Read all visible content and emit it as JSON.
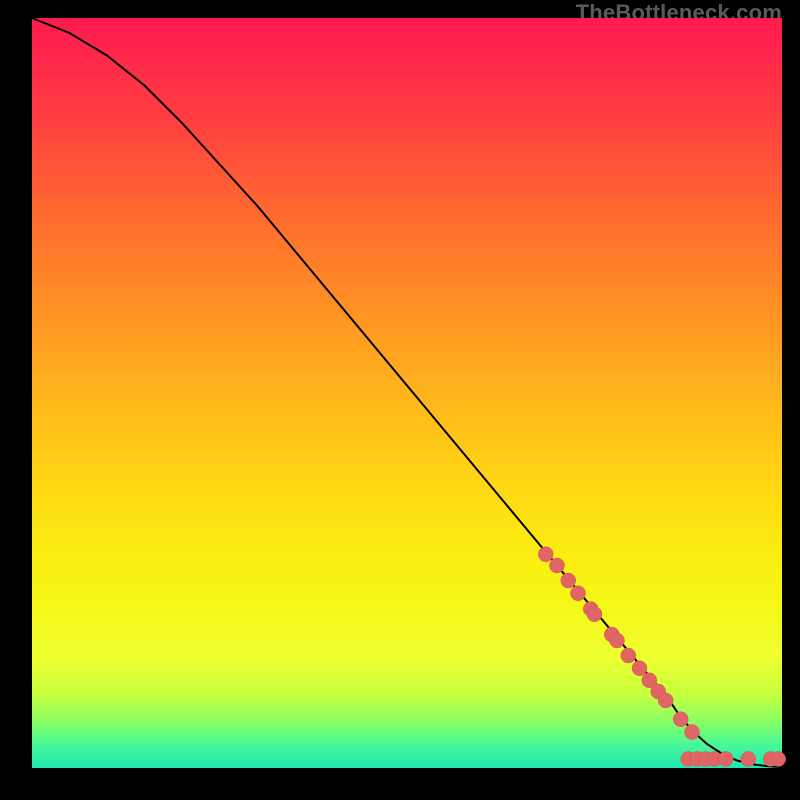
{
  "watermark": "TheBottleneck.com",
  "colors": {
    "page_bg": "#000000",
    "marker_fill": "#e06666",
    "marker_stroke": "#d94f4f",
    "curve_stroke": "#000000"
  },
  "chart_data": {
    "type": "line",
    "title": "",
    "xlabel": "",
    "ylabel": "",
    "xlim": [
      0,
      100
    ],
    "ylim": [
      0,
      100
    ],
    "grid": false,
    "legend": false,
    "series": [
      {
        "name": "curve",
        "kind": "line",
        "x": [
          0,
          5,
          10,
          15,
          20,
          25,
          30,
          35,
          40,
          45,
          50,
          55,
          60,
          65,
          70,
          75,
          80,
          85,
          86,
          88,
          90,
          92,
          94,
          96,
          98,
          100
        ],
        "y": [
          100,
          98,
          95,
          91,
          86,
          80.5,
          75,
          69,
          63,
          57,
          51,
          45,
          39,
          33,
          27,
          21,
          15,
          9,
          7.5,
          5.0,
          3.2,
          1.9,
          1.0,
          0.5,
          0.25,
          0.12
        ]
      },
      {
        "name": "markers",
        "kind": "scatter",
        "points": [
          {
            "x": 68.5,
            "y": 28.5
          },
          {
            "x": 70.0,
            "y": 27.0
          },
          {
            "x": 71.5,
            "y": 25.0
          },
          {
            "x": 72.8,
            "y": 23.3
          },
          {
            "x": 74.5,
            "y": 21.2
          },
          {
            "x": 75.0,
            "y": 20.5
          },
          {
            "x": 77.3,
            "y": 17.8
          },
          {
            "x": 78.0,
            "y": 17.0
          },
          {
            "x": 79.5,
            "y": 15.0
          },
          {
            "x": 81.0,
            "y": 13.3
          },
          {
            "x": 82.3,
            "y": 11.7
          },
          {
            "x": 83.5,
            "y": 10.2
          },
          {
            "x": 84.5,
            "y": 9.0
          },
          {
            "x": 86.5,
            "y": 6.5
          },
          {
            "x": 88.0,
            "y": 4.8
          },
          {
            "x": 87.5,
            "y": 1.2
          },
          {
            "x": 88.7,
            "y": 1.2
          },
          {
            "x": 89.8,
            "y": 1.2
          },
          {
            "x": 91.0,
            "y": 1.2
          },
          {
            "x": 92.5,
            "y": 1.2
          },
          {
            "x": 95.5,
            "y": 1.2
          },
          {
            "x": 98.5,
            "y": 1.2
          },
          {
            "x": 99.5,
            "y": 1.2
          }
        ]
      }
    ]
  }
}
